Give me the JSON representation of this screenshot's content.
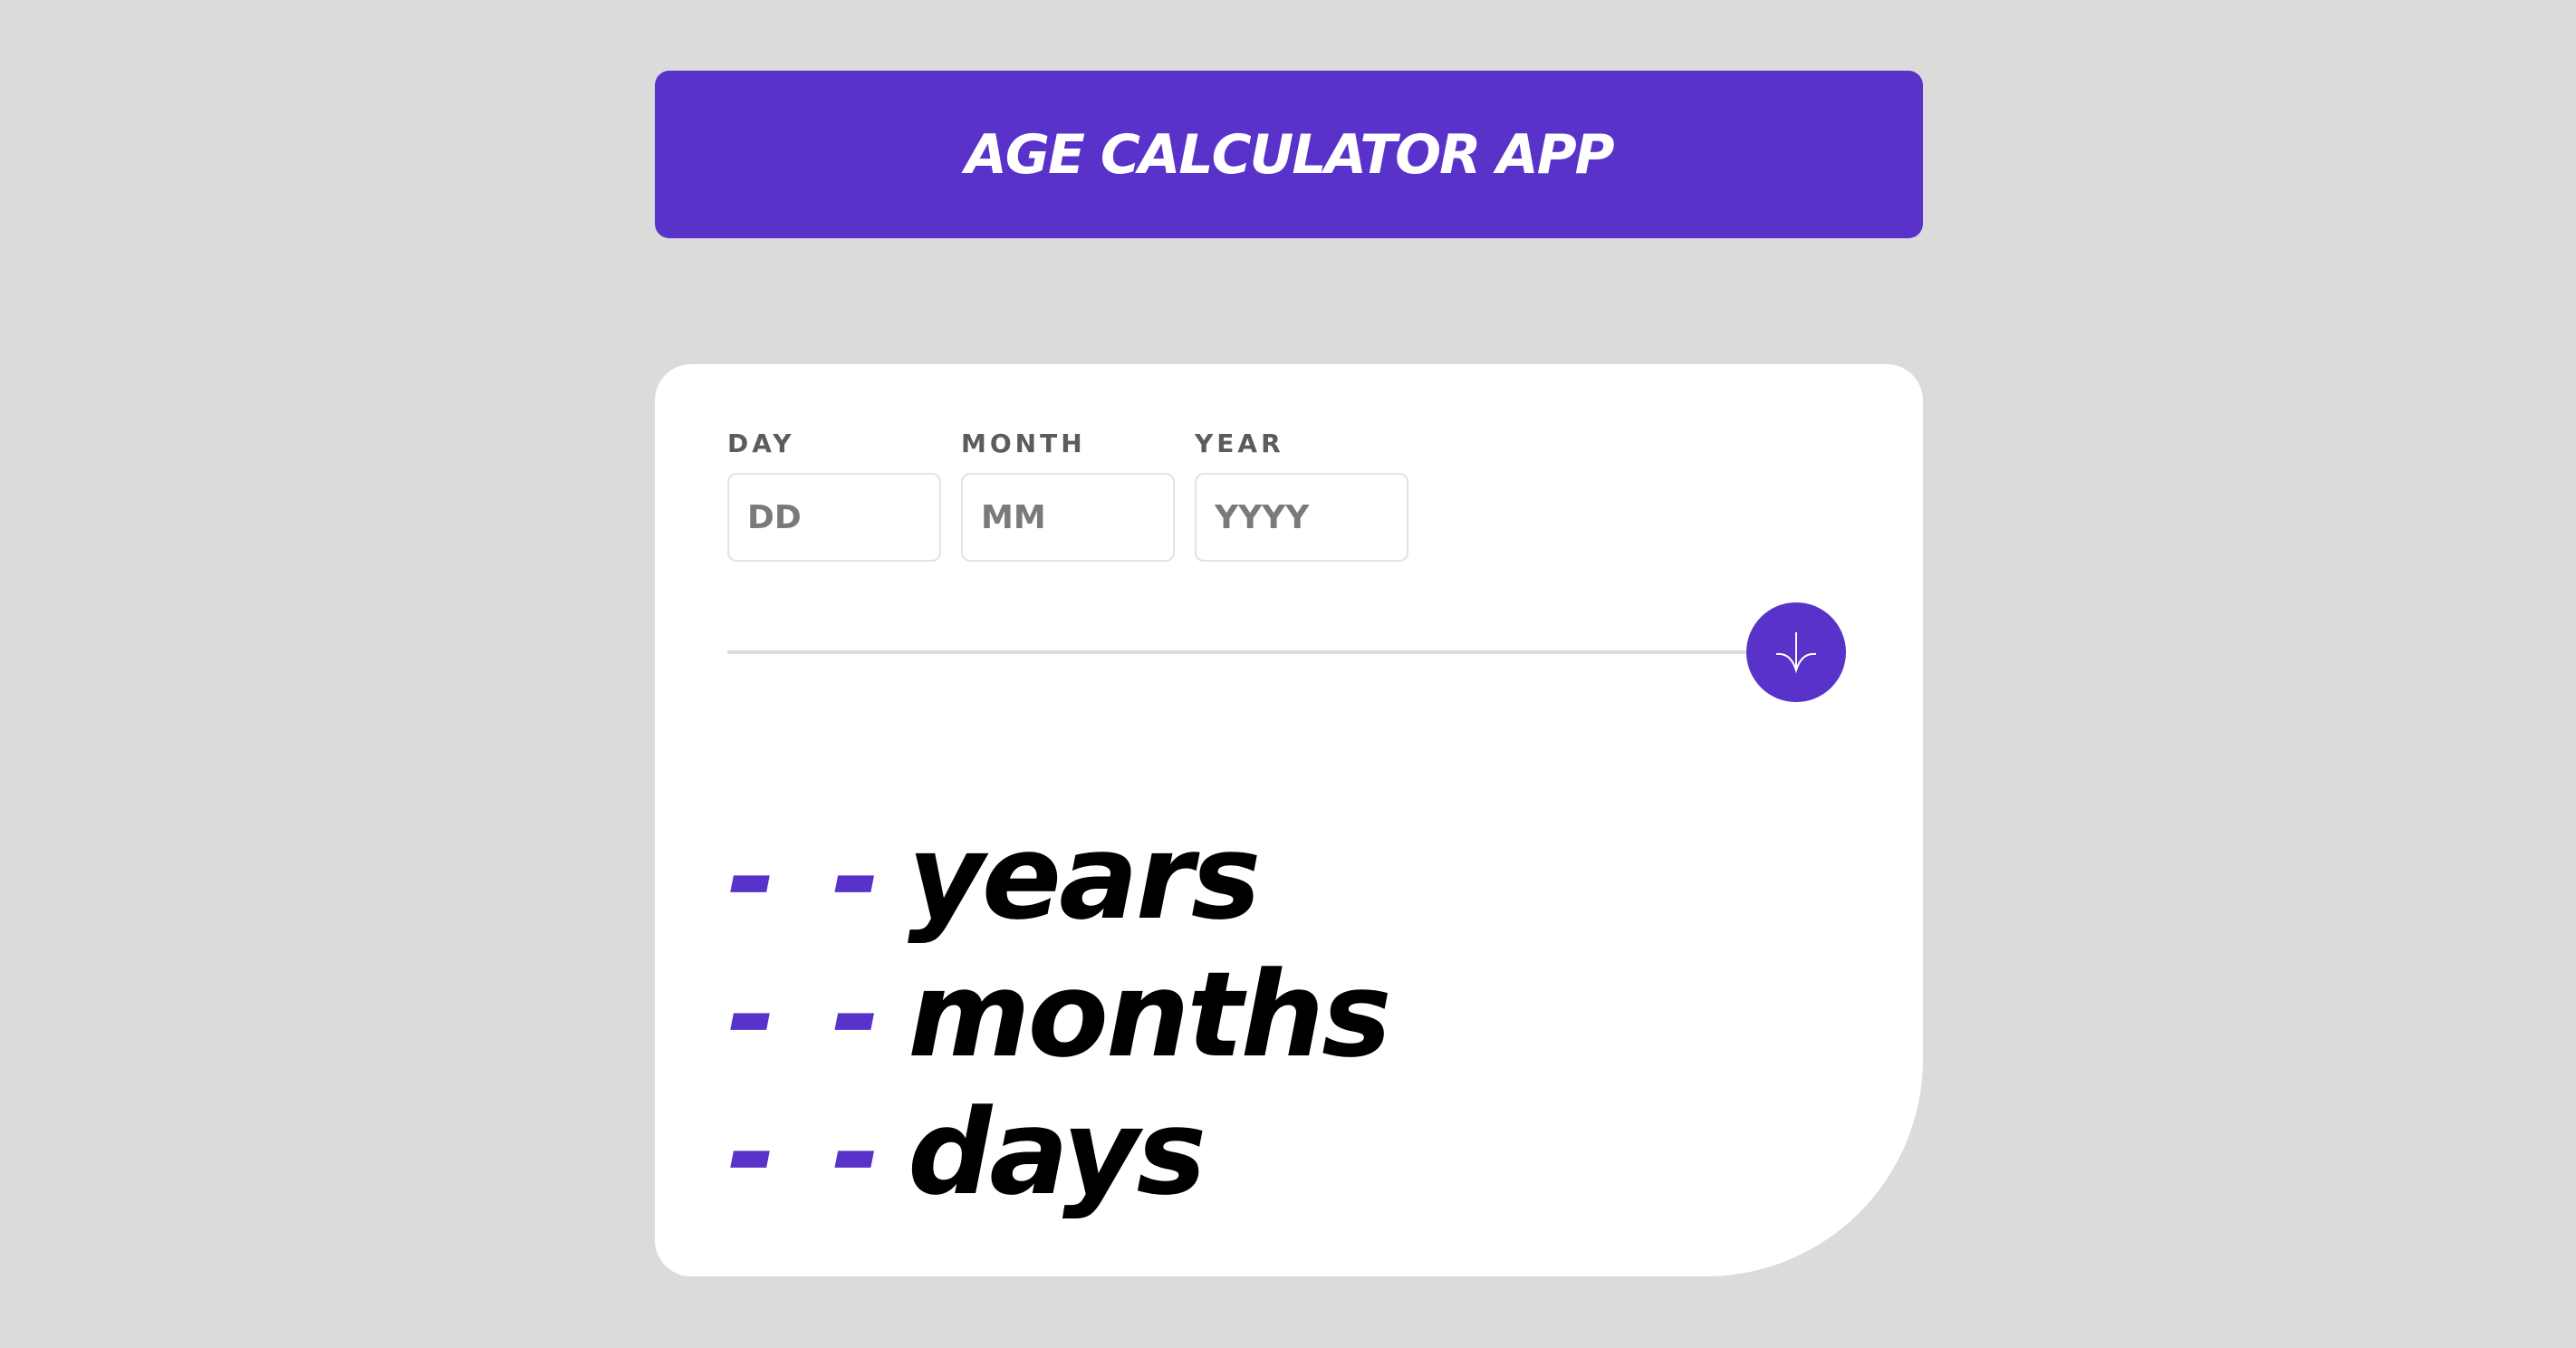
{
  "app": {
    "title": "AGE CALCULATOR APP"
  },
  "form": {
    "day": {
      "label": "DAY",
      "placeholder": "DD",
      "value": ""
    },
    "month": {
      "label": "MONTH",
      "placeholder": "MM",
      "value": ""
    },
    "year": {
      "label": "YEAR",
      "placeholder": "YYYY",
      "value": ""
    },
    "submit_icon": "arrow-down-icon"
  },
  "results": {
    "years": {
      "value": "- -",
      "unit": "years"
    },
    "months": {
      "value": "- -",
      "unit": "months"
    },
    "days": {
      "value": "- -",
      "unit": "days"
    }
  },
  "colors": {
    "accent": "#5933c9",
    "background": "#dbdbdb",
    "card": "#ffffff",
    "label": "#5c5c5c",
    "result_text": "#000000"
  }
}
